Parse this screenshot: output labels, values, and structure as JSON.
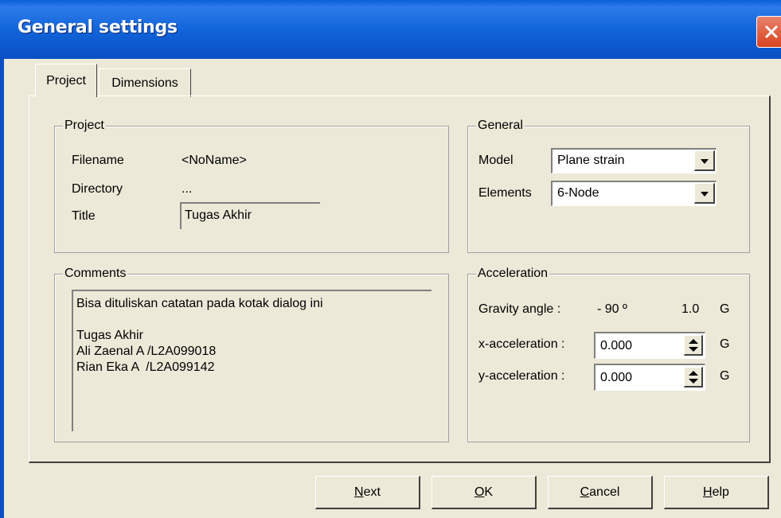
{
  "window": {
    "title": "General settings"
  },
  "tabs": [
    {
      "label": "Project"
    },
    {
      "label": "Dimensions"
    }
  ],
  "project": {
    "legend": "Project",
    "filename_label": "Filename",
    "filename_value": "<NoName>",
    "directory_label": "Directory",
    "directory_value": "...",
    "title_label": "Title",
    "title_value": "Tugas Akhir"
  },
  "general": {
    "legend": "General",
    "model_label": "Model",
    "model_value": "Plane strain",
    "elements_label": "Elements",
    "elements_value": "6-Node"
  },
  "comments": {
    "legend": "Comments",
    "lines": [
      "Bisa dituliskan catatan pada kotak dialog ini",
      "",
      "Tugas Akhir",
      "Ali Zaenal A /L2A099018",
      "Rian Eka A  /L2A099142"
    ]
  },
  "acceleration": {
    "legend": "Acceleration",
    "gravity_label": "Gravity angle :",
    "gravity_angle": "- 90 º",
    "gravity_value": "1.0",
    "gravity_unit": "G",
    "x_label": "x-acceleration :",
    "x_value": "0.000",
    "x_unit": "G",
    "y_label": "y-acceleration :",
    "y_value": "0.000",
    "y_unit": "G"
  },
  "buttons": {
    "next_first": "N",
    "next_rest": "ext",
    "ok_first": "O",
    "ok_rest": "K",
    "cancel_first": "C",
    "cancel_rest": "ancel",
    "help_first": "H",
    "help_rest": "elp"
  }
}
